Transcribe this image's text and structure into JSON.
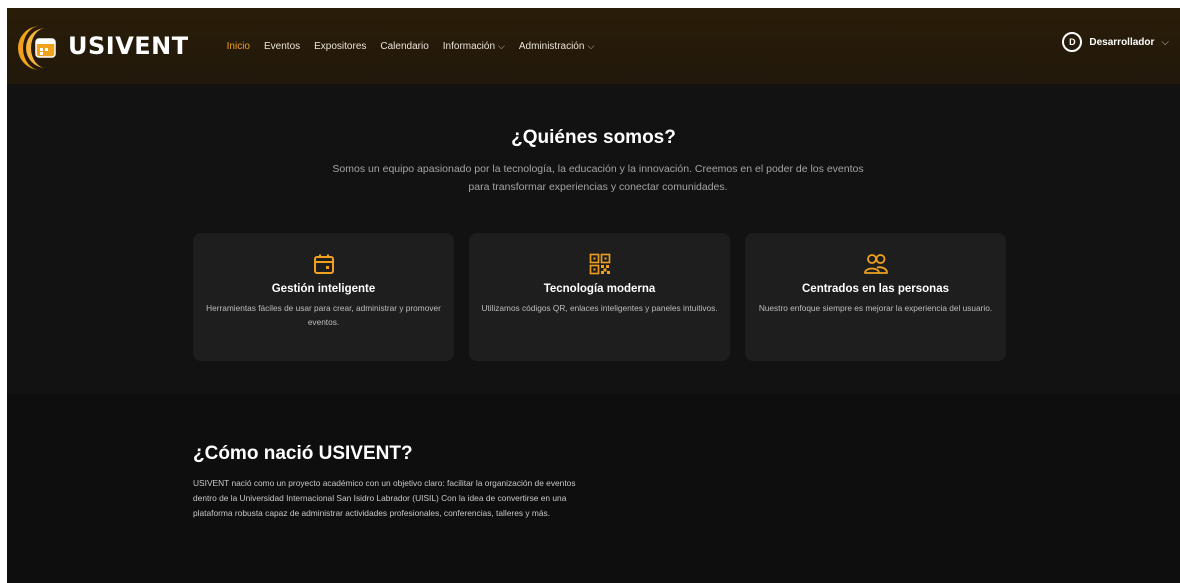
{
  "brand": {
    "name": "USIVENT"
  },
  "nav": {
    "items": [
      {
        "label": "Inicio",
        "active": true,
        "has_dropdown": false
      },
      {
        "label": "Eventos",
        "active": false,
        "has_dropdown": false
      },
      {
        "label": "Expositores",
        "active": false,
        "has_dropdown": false
      },
      {
        "label": "Calendario",
        "active": false,
        "has_dropdown": false
      },
      {
        "label": "Información",
        "active": false,
        "has_dropdown": true
      },
      {
        "label": "Administración",
        "active": false,
        "has_dropdown": true
      }
    ]
  },
  "user": {
    "initial": "D",
    "name": "Desarrollador"
  },
  "about": {
    "title": "¿Quiénes somos?",
    "description": "Somos un equipo apasionado por la tecnología, la educación y la innovación. Creemos en el poder de los eventos para transformar experiencias y conectar comunidades.",
    "cards": [
      {
        "icon": "calendar-icon",
        "title": "Gestión inteligente",
        "description": "Herramientas fáciles de usar para crear, administrar y promover eventos."
      },
      {
        "icon": "qr-code-icon",
        "title": "Tecnología moderna",
        "description": "Utilizamos códigos QR, enlaces inteligentes y paneles intuitivos."
      },
      {
        "icon": "users-icon",
        "title": "Centrados en las personas",
        "description": "Nuestro enfoque siempre es mejorar la experiencia del usuario."
      }
    ]
  },
  "history": {
    "title": "¿Cómo nació USIVENT?",
    "text": "USIVENT nació como un proyecto académico con un objetivo claro: facilitar la organización de eventos dentro de la Universidad Internacional San Isidro Labrador (UISIL) Con la idea de convertirse en una plataforma robusta capaz de administrar actividades profesionales, conferencias, talleres y más."
  },
  "colors": {
    "accent": "#f0a21e",
    "navbar_bg": "#261b09",
    "page_bg": "#121212",
    "card_bg": "#1e1e1e"
  }
}
